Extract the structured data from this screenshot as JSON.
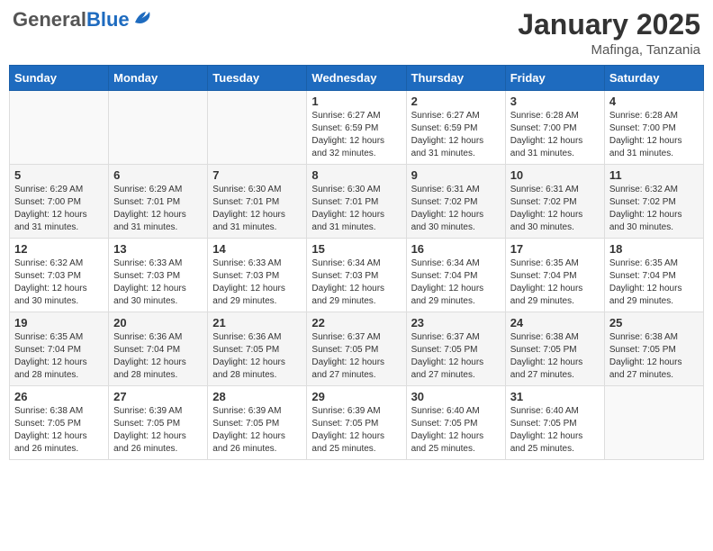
{
  "header": {
    "logo_general": "General",
    "logo_blue": "Blue",
    "month_year": "January 2025",
    "location": "Mafinga, Tanzania"
  },
  "weekdays": [
    "Sunday",
    "Monday",
    "Tuesday",
    "Wednesday",
    "Thursday",
    "Friday",
    "Saturday"
  ],
  "weeks": [
    [
      {
        "day": "",
        "info": ""
      },
      {
        "day": "",
        "info": ""
      },
      {
        "day": "",
        "info": ""
      },
      {
        "day": "1",
        "info": "Sunrise: 6:27 AM\nSunset: 6:59 PM\nDaylight: 12 hours\nand 32 minutes."
      },
      {
        "day": "2",
        "info": "Sunrise: 6:27 AM\nSunset: 6:59 PM\nDaylight: 12 hours\nand 31 minutes."
      },
      {
        "day": "3",
        "info": "Sunrise: 6:28 AM\nSunset: 7:00 PM\nDaylight: 12 hours\nand 31 minutes."
      },
      {
        "day": "4",
        "info": "Sunrise: 6:28 AM\nSunset: 7:00 PM\nDaylight: 12 hours\nand 31 minutes."
      }
    ],
    [
      {
        "day": "5",
        "info": "Sunrise: 6:29 AM\nSunset: 7:00 PM\nDaylight: 12 hours\nand 31 minutes."
      },
      {
        "day": "6",
        "info": "Sunrise: 6:29 AM\nSunset: 7:01 PM\nDaylight: 12 hours\nand 31 minutes."
      },
      {
        "day": "7",
        "info": "Sunrise: 6:30 AM\nSunset: 7:01 PM\nDaylight: 12 hours\nand 31 minutes."
      },
      {
        "day": "8",
        "info": "Sunrise: 6:30 AM\nSunset: 7:01 PM\nDaylight: 12 hours\nand 31 minutes."
      },
      {
        "day": "9",
        "info": "Sunrise: 6:31 AM\nSunset: 7:02 PM\nDaylight: 12 hours\nand 30 minutes."
      },
      {
        "day": "10",
        "info": "Sunrise: 6:31 AM\nSunset: 7:02 PM\nDaylight: 12 hours\nand 30 minutes."
      },
      {
        "day": "11",
        "info": "Sunrise: 6:32 AM\nSunset: 7:02 PM\nDaylight: 12 hours\nand 30 minutes."
      }
    ],
    [
      {
        "day": "12",
        "info": "Sunrise: 6:32 AM\nSunset: 7:03 PM\nDaylight: 12 hours\nand 30 minutes."
      },
      {
        "day": "13",
        "info": "Sunrise: 6:33 AM\nSunset: 7:03 PM\nDaylight: 12 hours\nand 30 minutes."
      },
      {
        "day": "14",
        "info": "Sunrise: 6:33 AM\nSunset: 7:03 PM\nDaylight: 12 hours\nand 29 minutes."
      },
      {
        "day": "15",
        "info": "Sunrise: 6:34 AM\nSunset: 7:03 PM\nDaylight: 12 hours\nand 29 minutes."
      },
      {
        "day": "16",
        "info": "Sunrise: 6:34 AM\nSunset: 7:04 PM\nDaylight: 12 hours\nand 29 minutes."
      },
      {
        "day": "17",
        "info": "Sunrise: 6:35 AM\nSunset: 7:04 PM\nDaylight: 12 hours\nand 29 minutes."
      },
      {
        "day": "18",
        "info": "Sunrise: 6:35 AM\nSunset: 7:04 PM\nDaylight: 12 hours\nand 29 minutes."
      }
    ],
    [
      {
        "day": "19",
        "info": "Sunrise: 6:35 AM\nSunset: 7:04 PM\nDaylight: 12 hours\nand 28 minutes."
      },
      {
        "day": "20",
        "info": "Sunrise: 6:36 AM\nSunset: 7:04 PM\nDaylight: 12 hours\nand 28 minutes."
      },
      {
        "day": "21",
        "info": "Sunrise: 6:36 AM\nSunset: 7:05 PM\nDaylight: 12 hours\nand 28 minutes."
      },
      {
        "day": "22",
        "info": "Sunrise: 6:37 AM\nSunset: 7:05 PM\nDaylight: 12 hours\nand 27 minutes."
      },
      {
        "day": "23",
        "info": "Sunrise: 6:37 AM\nSunset: 7:05 PM\nDaylight: 12 hours\nand 27 minutes."
      },
      {
        "day": "24",
        "info": "Sunrise: 6:38 AM\nSunset: 7:05 PM\nDaylight: 12 hours\nand 27 minutes."
      },
      {
        "day": "25",
        "info": "Sunrise: 6:38 AM\nSunset: 7:05 PM\nDaylight: 12 hours\nand 27 minutes."
      }
    ],
    [
      {
        "day": "26",
        "info": "Sunrise: 6:38 AM\nSunset: 7:05 PM\nDaylight: 12 hours\nand 26 minutes."
      },
      {
        "day": "27",
        "info": "Sunrise: 6:39 AM\nSunset: 7:05 PM\nDaylight: 12 hours\nand 26 minutes."
      },
      {
        "day": "28",
        "info": "Sunrise: 6:39 AM\nSunset: 7:05 PM\nDaylight: 12 hours\nand 26 minutes."
      },
      {
        "day": "29",
        "info": "Sunrise: 6:39 AM\nSunset: 7:05 PM\nDaylight: 12 hours\nand 25 minutes."
      },
      {
        "day": "30",
        "info": "Sunrise: 6:40 AM\nSunset: 7:05 PM\nDaylight: 12 hours\nand 25 minutes."
      },
      {
        "day": "31",
        "info": "Sunrise: 6:40 AM\nSunset: 7:05 PM\nDaylight: 12 hours\nand 25 minutes."
      },
      {
        "day": "",
        "info": ""
      }
    ]
  ]
}
